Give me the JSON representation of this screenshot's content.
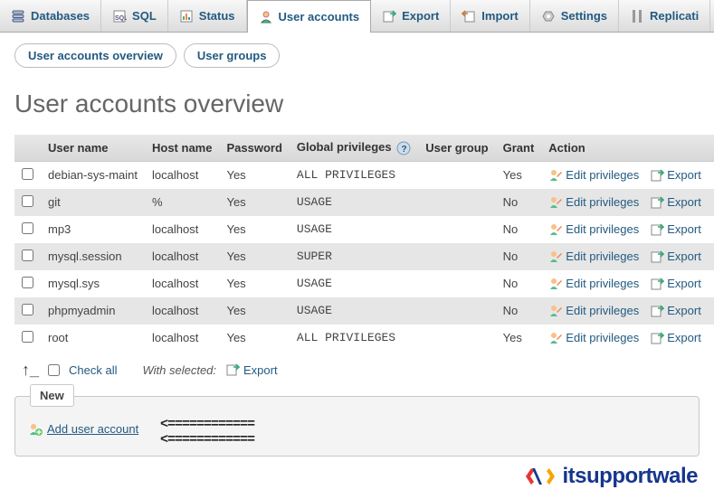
{
  "topTabs": [
    {
      "id": "databases",
      "label": "Databases"
    },
    {
      "id": "sql",
      "label": "SQL"
    },
    {
      "id": "status",
      "label": "Status"
    },
    {
      "id": "user-accounts",
      "label": "User accounts",
      "active": true
    },
    {
      "id": "export",
      "label": "Export"
    },
    {
      "id": "import",
      "label": "Import"
    },
    {
      "id": "settings",
      "label": "Settings"
    },
    {
      "id": "replication",
      "label": "Replicati"
    }
  ],
  "subTabs": {
    "overview": "User accounts overview",
    "groups": "User groups"
  },
  "pageTitle": "User accounts overview",
  "table": {
    "headers": {
      "userName": "User name",
      "hostName": "Host name",
      "password": "Password",
      "globalPrivileges": "Global privileges",
      "userGroup": "User group",
      "grant": "Grant",
      "action": "Action"
    },
    "actionLabels": {
      "editPrivileges": "Edit privileges",
      "export": "Export"
    },
    "rows": [
      {
        "userName": "debian-sys-maint",
        "hostName": "localhost",
        "password": "Yes",
        "globalPrivileges": "ALL PRIVILEGES",
        "userGroup": "",
        "grant": "Yes"
      },
      {
        "userName": "git",
        "hostName": "%",
        "password": "Yes",
        "globalPrivileges": "USAGE",
        "userGroup": "",
        "grant": "No"
      },
      {
        "userName": "mp3",
        "hostName": "localhost",
        "password": "Yes",
        "globalPrivileges": "USAGE",
        "userGroup": "",
        "grant": "No"
      },
      {
        "userName": "mysql.session",
        "hostName": "localhost",
        "password": "Yes",
        "globalPrivileges": "SUPER",
        "userGroup": "",
        "grant": "No"
      },
      {
        "userName": "mysql.sys",
        "hostName": "localhost",
        "password": "Yes",
        "globalPrivileges": "USAGE",
        "userGroup": "",
        "grant": "No"
      },
      {
        "userName": "phpmyadmin",
        "hostName": "localhost",
        "password": "Yes",
        "globalPrivileges": "USAGE",
        "userGroup": "",
        "grant": "No"
      },
      {
        "userName": "root",
        "hostName": "localhost",
        "password": "Yes",
        "globalPrivileges": "ALL PRIVILEGES",
        "userGroup": "",
        "grant": "Yes"
      }
    ]
  },
  "footer": {
    "checkAll": "Check all",
    "withSelected": "With selected:",
    "export": "Export"
  },
  "newBox": {
    "legend": "New",
    "addUser": "Add user account"
  },
  "watermark": "itsupportwale"
}
